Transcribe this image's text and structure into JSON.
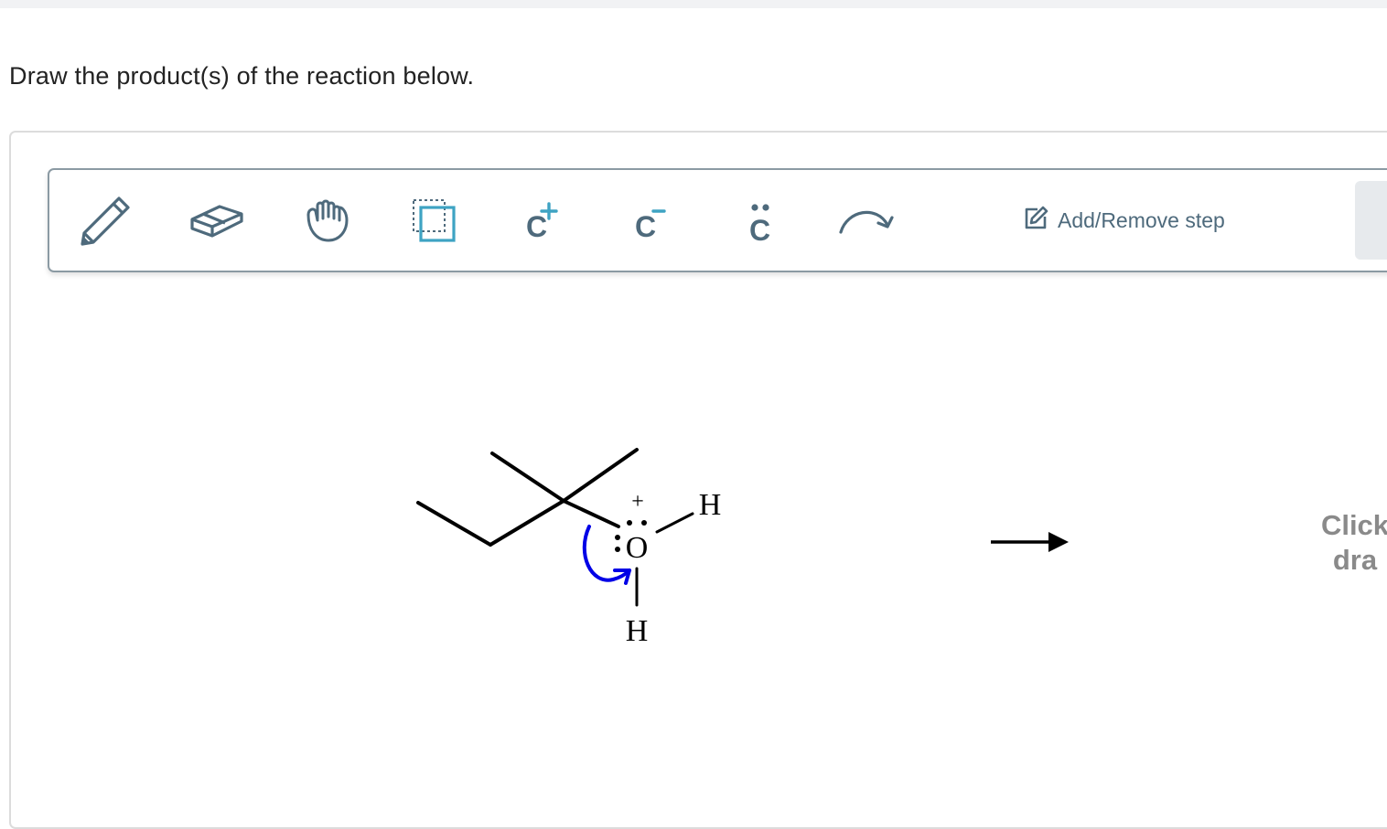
{
  "question": {
    "text": "Draw the product(s) of the reaction below."
  },
  "toolbar": {
    "tools": [
      {
        "name": "pencil-tool",
        "icon": "pencil-icon"
      },
      {
        "name": "eraser-tool",
        "icon": "eraser-icon"
      },
      {
        "name": "hand-tool",
        "icon": "hand-icon"
      },
      {
        "name": "select-tool",
        "icon": "selection-box-icon"
      },
      {
        "name": "positive-charge-tool",
        "icon": "carbocation-icon",
        "label": "C",
        "superscript": "+"
      },
      {
        "name": "negative-charge-tool",
        "icon": "carbanion-icon",
        "label": "C",
        "superscript": "−"
      },
      {
        "name": "lone-pair-tool",
        "icon": "lone-pair-icon",
        "label": "C"
      },
      {
        "name": "curved-arrow-tool",
        "icon": "curved-arrow-icon"
      }
    ],
    "add_remove_step": "Add/Remove step",
    "icon_color": "#4e6a7c",
    "accent_color": "#3ea3c3"
  },
  "molecule": {
    "atoms": {
      "oxygen": "O",
      "oxygen_charge": "+",
      "hydrogen_right": "H",
      "hydrogen_bottom": "H"
    },
    "mechanism_arrow_color": "#0000e6"
  },
  "canvas_hint": {
    "line1": "Click",
    "line2": "dra"
  }
}
